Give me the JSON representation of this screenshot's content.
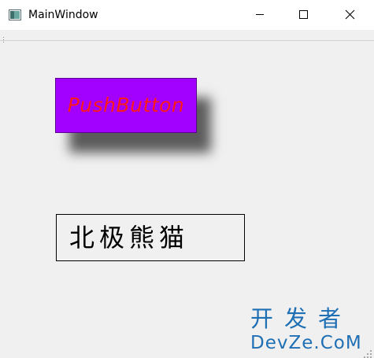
{
  "window": {
    "title": "MainWindow",
    "icon": "qt-window-icon",
    "controls": {
      "minimize": "minimize-icon",
      "maximize": "maximize-icon",
      "close": "close-icon"
    }
  },
  "central": {
    "push_button": {
      "label": "PushButton",
      "background": "#a200ff",
      "text_color": "#ff1a1a"
    },
    "label": {
      "text": "北极熊猫"
    }
  },
  "watermark": {
    "line1": "开发者",
    "line2": "DevZe.CoM"
  }
}
